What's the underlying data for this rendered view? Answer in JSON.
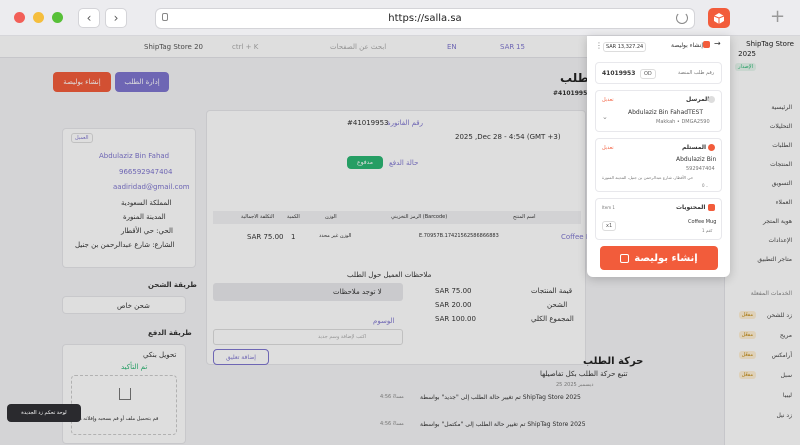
{
  "browser": {
    "url": "https://salla.sa"
  },
  "topbar": {
    "store": "ShipTag Store 20",
    "search_placeholder": "ابحث عن الصفحات",
    "shortcut": "ctrl + K",
    "lang": "EN",
    "currency": "SAR",
    "count": "15"
  },
  "sidebar": {
    "store_name": "ShipTag Store",
    "store_year": "2025",
    "badge": "الإصدار",
    "items": [
      "الرئيسية",
      "التحليلات",
      "الطلبات",
      "المنتجات",
      "التسويق",
      "العملاء",
      "هوية المتجر",
      "الإعدادات",
      "متاجر التطبيق"
    ],
    "section": "الخدمات المفعلة",
    "apps": [
      "زد للشحن",
      "مريح",
      "أرامكس",
      "سبل",
      "ليبيا",
      "زد نيل"
    ],
    "pills": [
      "مفعّل",
      "مفعّل",
      "مفعّل",
      "مفعّل"
    ]
  },
  "header": {
    "title": "الطلب",
    "order_no": "#41019953",
    "create_shipment_button": "إنشاء بوليصة",
    "manage_order_button": "إدارة الطلب"
  },
  "order": {
    "invoice_label": "رقم الفاتورة",
    "invoice_value": "#41019953",
    "date": "2025 ,Dec 28 - 4:54 (GMT +3)",
    "status_label": "حالة الدفع",
    "status_value": "مدفوع",
    "table_headers": [
      "اسم المنتج",
      "الرمز التخزيني (Barcode)",
      "الوزن",
      "الكمية",
      "التكلفة الاجمالية"
    ],
    "item_name": "Coffee M",
    "item_barcode": "E.70957B.17421562586866883",
    "item_weight": "الوزن غير محدد",
    "item_qty": "1",
    "item_price": "SAR 75.00",
    "customer_notes_label": "ملاحظات العميل حول الطلب",
    "no_notes": "لا توجد ملاحظات",
    "tags_label": "الوسوم",
    "tags_placeholder": "اكتب لإضافة وسم جديد",
    "add_comment_button": "إضافة تعليق",
    "totals": [
      {
        "label": "قيمة المنتجات",
        "value": "SAR 75.00"
      },
      {
        "label": "الشحن",
        "value": "SAR 20.00"
      },
      {
        "label": "المجموع الكلي",
        "value": "SAR 100.00"
      }
    ]
  },
  "movement": {
    "title": "حركة الطلب",
    "subtitle": "تتبع حركة الطلب بكل تفاصيلها",
    "day": "25 ديسمبر 2025",
    "entries": [
      {
        "text": "تم تغيير حالة الطلب إلى \"جديد\" بواسطة ShipTag Store 2025",
        "time": "4:56 مساءً"
      },
      {
        "text": "تم تغيير حالة الطلب إلى \"مكتمل\" بواسطة ShipTag Store 2025",
        "time": "4:56 مساءً"
      }
    ]
  },
  "customer": {
    "tab": "العميل",
    "name": "Abdulaziz Bin Fahad",
    "phone": "966592947404",
    "email": "aadiridad@gmail.com",
    "country": "المملكة السعودية",
    "city": "المدينة المنورة",
    "district": "الحي: حي الأقطار",
    "street": "الشارع: شارع عبدالرحمن بن جنيل",
    "shipping_label": "طريقة الشحن",
    "shipping_value": "شحن خاص",
    "payment_label": "طريقة الدفع",
    "payment_value": "تحويل بنكي",
    "payment_status": "تم التأكيد",
    "upload_text": "قم بتحميل ملف أو قم بسحبه وإفلاته هنا"
  },
  "toast": {
    "text": "لوحة تحكم زد الجديدة"
  },
  "popup": {
    "title": "إنشاء بوليصة",
    "balance": "SAR 13,327.24",
    "order_id_label": "رقم طلب المنصة",
    "order_id": "41019953",
    "order_id_prefix": "OD",
    "sender_label": "المرسل",
    "sender_edit": "تعديل",
    "sender_name": "Abdulaziz Bin FahadTEST",
    "sender_addr": "Makkah • DMGA2590",
    "recipient_label": "المستلم",
    "recipient_edit": "تعديل",
    "recipient_name": "Abdulaziz Bin",
    "recipient_phone": "592947404",
    "recipient_addr": "حي الأقطار، شارع عبدالرحمن بن جنيل، المدينة المنورة",
    "recipient_zip": "0 ..",
    "parcel_label": "المحتويات",
    "parcel_count": "Item 1",
    "parcel_item": "Coffee Mug",
    "parcel_weight": "1 كغم",
    "parcel_qty": "x1",
    "submit_button": "إنشاء بوليصة"
  },
  "colors": {
    "accent": "#f25c3b",
    "purple": "#7f76cf",
    "green": "#2bb673"
  }
}
